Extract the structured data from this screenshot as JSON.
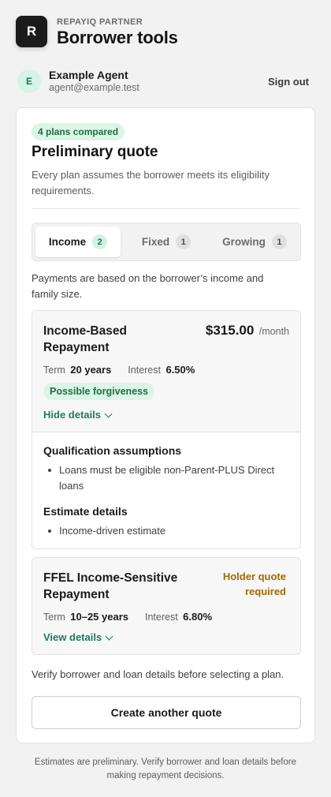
{
  "app": {
    "logo_letter": "R",
    "eyebrow": "REPAYIQ PARTNER",
    "title": "Borrower tools"
  },
  "agent": {
    "initial": "E",
    "name": "Example Agent",
    "email": "agent@example.test",
    "sign_out_label": "Sign out"
  },
  "quote": {
    "plans_badge": "4 plans compared",
    "title": "Preliminary quote",
    "subtitle": "Every plan assumes the borrower meets its eligibility requirements."
  },
  "tabs": [
    {
      "label": "Income",
      "count": "2",
      "active": true
    },
    {
      "label": "Fixed",
      "count": "1",
      "active": false
    },
    {
      "label": "Growing",
      "count": "1",
      "active": false
    }
  ],
  "tab_description": "Payments are based on the borrower’s income and family size.",
  "plans": [
    {
      "name": "Income-Based Repayment",
      "price": "$315.00",
      "price_unit": "/month",
      "term_label": "Term",
      "term_value": "20 years",
      "interest_label": "Interest",
      "interest_value": "6.50%",
      "badge": "Possible forgiveness",
      "toggle_label": "Hide details",
      "expanded": true,
      "details": {
        "qualification_heading": "Qualification assumptions",
        "qualification_items": [
          "Loans must be eligible non-Parent-PLUS Direct loans"
        ],
        "estimate_heading": "Estimate details",
        "estimate_items": [
          "Income-driven estimate"
        ]
      }
    },
    {
      "name": "FFEL Income-Sensitive Repayment",
      "status": "Holder quote required",
      "term_label": "Term",
      "term_value": "10–25 years",
      "interest_label": "Interest",
      "interest_value": "6.80%",
      "toggle_label": "View details",
      "expanded": false
    }
  ],
  "verify_text": "Verify borrower and loan details before selecting a plan.",
  "create_button_label": "Create another quote",
  "footer_note": "Estimates are preliminary. Verify borrower and loan details before making repayment decisions.",
  "colors": {
    "accent_green": "#1f7a60",
    "badge_green_bg": "#dcf5e6",
    "warning_amber": "#a26800"
  }
}
